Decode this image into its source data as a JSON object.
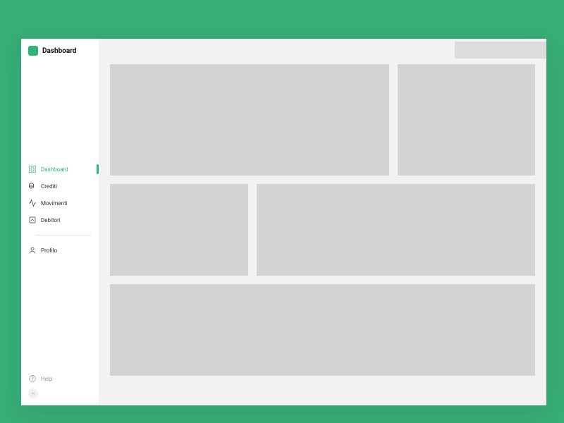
{
  "brand": {
    "title": "Dashboard"
  },
  "colors": {
    "accent": "#2fb573",
    "bg": "#38ad76"
  },
  "sidebar": {
    "items": [
      {
        "label": "Dashboard",
        "icon": "grid-icon",
        "active": true
      },
      {
        "label": "Crediti",
        "icon": "coins-icon"
      },
      {
        "label": "Movimenti",
        "icon": "activity-icon"
      },
      {
        "label": "Debitori",
        "icon": "user-up-icon"
      }
    ],
    "secondary": [
      {
        "label": "Profilo",
        "icon": "person-icon"
      }
    ],
    "help": {
      "label": "Help"
    }
  }
}
